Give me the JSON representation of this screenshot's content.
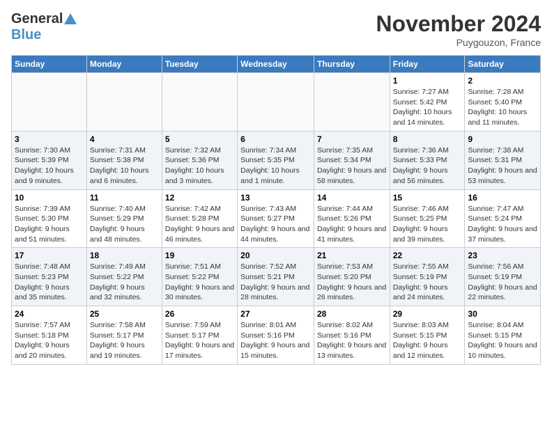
{
  "header": {
    "logo_line1": "General",
    "logo_line2": "Blue",
    "month_title": "November 2024",
    "location": "Puygouzon, France"
  },
  "days_of_week": [
    "Sunday",
    "Monday",
    "Tuesday",
    "Wednesday",
    "Thursday",
    "Friday",
    "Saturday"
  ],
  "weeks": [
    [
      {
        "day": "",
        "info": ""
      },
      {
        "day": "",
        "info": ""
      },
      {
        "day": "",
        "info": ""
      },
      {
        "day": "",
        "info": ""
      },
      {
        "day": "",
        "info": ""
      },
      {
        "day": "1",
        "info": "Sunrise: 7:27 AM\nSunset: 5:42 PM\nDaylight: 10 hours and 14 minutes."
      },
      {
        "day": "2",
        "info": "Sunrise: 7:28 AM\nSunset: 5:40 PM\nDaylight: 10 hours and 11 minutes."
      }
    ],
    [
      {
        "day": "3",
        "info": "Sunrise: 7:30 AM\nSunset: 5:39 PM\nDaylight: 10 hours and 9 minutes."
      },
      {
        "day": "4",
        "info": "Sunrise: 7:31 AM\nSunset: 5:38 PM\nDaylight: 10 hours and 6 minutes."
      },
      {
        "day": "5",
        "info": "Sunrise: 7:32 AM\nSunset: 5:36 PM\nDaylight: 10 hours and 3 minutes."
      },
      {
        "day": "6",
        "info": "Sunrise: 7:34 AM\nSunset: 5:35 PM\nDaylight: 10 hours and 1 minute."
      },
      {
        "day": "7",
        "info": "Sunrise: 7:35 AM\nSunset: 5:34 PM\nDaylight: 9 hours and 58 minutes."
      },
      {
        "day": "8",
        "info": "Sunrise: 7:36 AM\nSunset: 5:33 PM\nDaylight: 9 hours and 56 minutes."
      },
      {
        "day": "9",
        "info": "Sunrise: 7:38 AM\nSunset: 5:31 PM\nDaylight: 9 hours and 53 minutes."
      }
    ],
    [
      {
        "day": "10",
        "info": "Sunrise: 7:39 AM\nSunset: 5:30 PM\nDaylight: 9 hours and 51 minutes."
      },
      {
        "day": "11",
        "info": "Sunrise: 7:40 AM\nSunset: 5:29 PM\nDaylight: 9 hours and 48 minutes."
      },
      {
        "day": "12",
        "info": "Sunrise: 7:42 AM\nSunset: 5:28 PM\nDaylight: 9 hours and 46 minutes."
      },
      {
        "day": "13",
        "info": "Sunrise: 7:43 AM\nSunset: 5:27 PM\nDaylight: 9 hours and 44 minutes."
      },
      {
        "day": "14",
        "info": "Sunrise: 7:44 AM\nSunset: 5:26 PM\nDaylight: 9 hours and 41 minutes."
      },
      {
        "day": "15",
        "info": "Sunrise: 7:46 AM\nSunset: 5:25 PM\nDaylight: 9 hours and 39 minutes."
      },
      {
        "day": "16",
        "info": "Sunrise: 7:47 AM\nSunset: 5:24 PM\nDaylight: 9 hours and 37 minutes."
      }
    ],
    [
      {
        "day": "17",
        "info": "Sunrise: 7:48 AM\nSunset: 5:23 PM\nDaylight: 9 hours and 35 minutes."
      },
      {
        "day": "18",
        "info": "Sunrise: 7:49 AM\nSunset: 5:22 PM\nDaylight: 9 hours and 32 minutes."
      },
      {
        "day": "19",
        "info": "Sunrise: 7:51 AM\nSunset: 5:22 PM\nDaylight: 9 hours and 30 minutes."
      },
      {
        "day": "20",
        "info": "Sunrise: 7:52 AM\nSunset: 5:21 PM\nDaylight: 9 hours and 28 minutes."
      },
      {
        "day": "21",
        "info": "Sunrise: 7:53 AM\nSunset: 5:20 PM\nDaylight: 9 hours and 26 minutes."
      },
      {
        "day": "22",
        "info": "Sunrise: 7:55 AM\nSunset: 5:19 PM\nDaylight: 9 hours and 24 minutes."
      },
      {
        "day": "23",
        "info": "Sunrise: 7:56 AM\nSunset: 5:19 PM\nDaylight: 9 hours and 22 minutes."
      }
    ],
    [
      {
        "day": "24",
        "info": "Sunrise: 7:57 AM\nSunset: 5:18 PM\nDaylight: 9 hours and 20 minutes."
      },
      {
        "day": "25",
        "info": "Sunrise: 7:58 AM\nSunset: 5:17 PM\nDaylight: 9 hours and 19 minutes."
      },
      {
        "day": "26",
        "info": "Sunrise: 7:59 AM\nSunset: 5:17 PM\nDaylight: 9 hours and 17 minutes."
      },
      {
        "day": "27",
        "info": "Sunrise: 8:01 AM\nSunset: 5:16 PM\nDaylight: 9 hours and 15 minutes."
      },
      {
        "day": "28",
        "info": "Sunrise: 8:02 AM\nSunset: 5:16 PM\nDaylight: 9 hours and 13 minutes."
      },
      {
        "day": "29",
        "info": "Sunrise: 8:03 AM\nSunset: 5:15 PM\nDaylight: 9 hours and 12 minutes."
      },
      {
        "day": "30",
        "info": "Sunrise: 8:04 AM\nSunset: 5:15 PM\nDaylight: 9 hours and 10 minutes."
      }
    ]
  ]
}
